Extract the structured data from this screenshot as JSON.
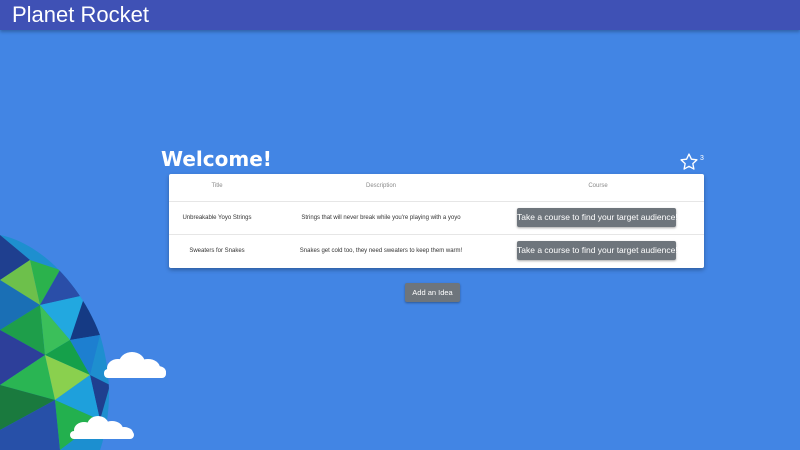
{
  "header": {
    "title": "Planet Rocket"
  },
  "main": {
    "welcome": "Welcome!",
    "favorites_count": "3",
    "table": {
      "columns": [
        "Title",
        "Description",
        "Course"
      ],
      "rows": [
        {
          "title": "Unbreakable Yoyo Strings",
          "description": "Strings that will never break while you're playing with a yoyo",
          "course_label": "Take a course to find your target audience!"
        },
        {
          "title": "Sweaters for Snakes",
          "description": "Snakes get cold too, they need sweaters to keep them warm!",
          "course_label": "Take a course to find your target audience!"
        }
      ]
    },
    "add_idea_label": "Add an Idea"
  },
  "icons": {
    "favorites": "star-outline-icon"
  },
  "colors": {
    "background": "#4285e4",
    "topbar": "#3f51b5",
    "button": "#6e757c",
    "card": "#ffffff"
  }
}
